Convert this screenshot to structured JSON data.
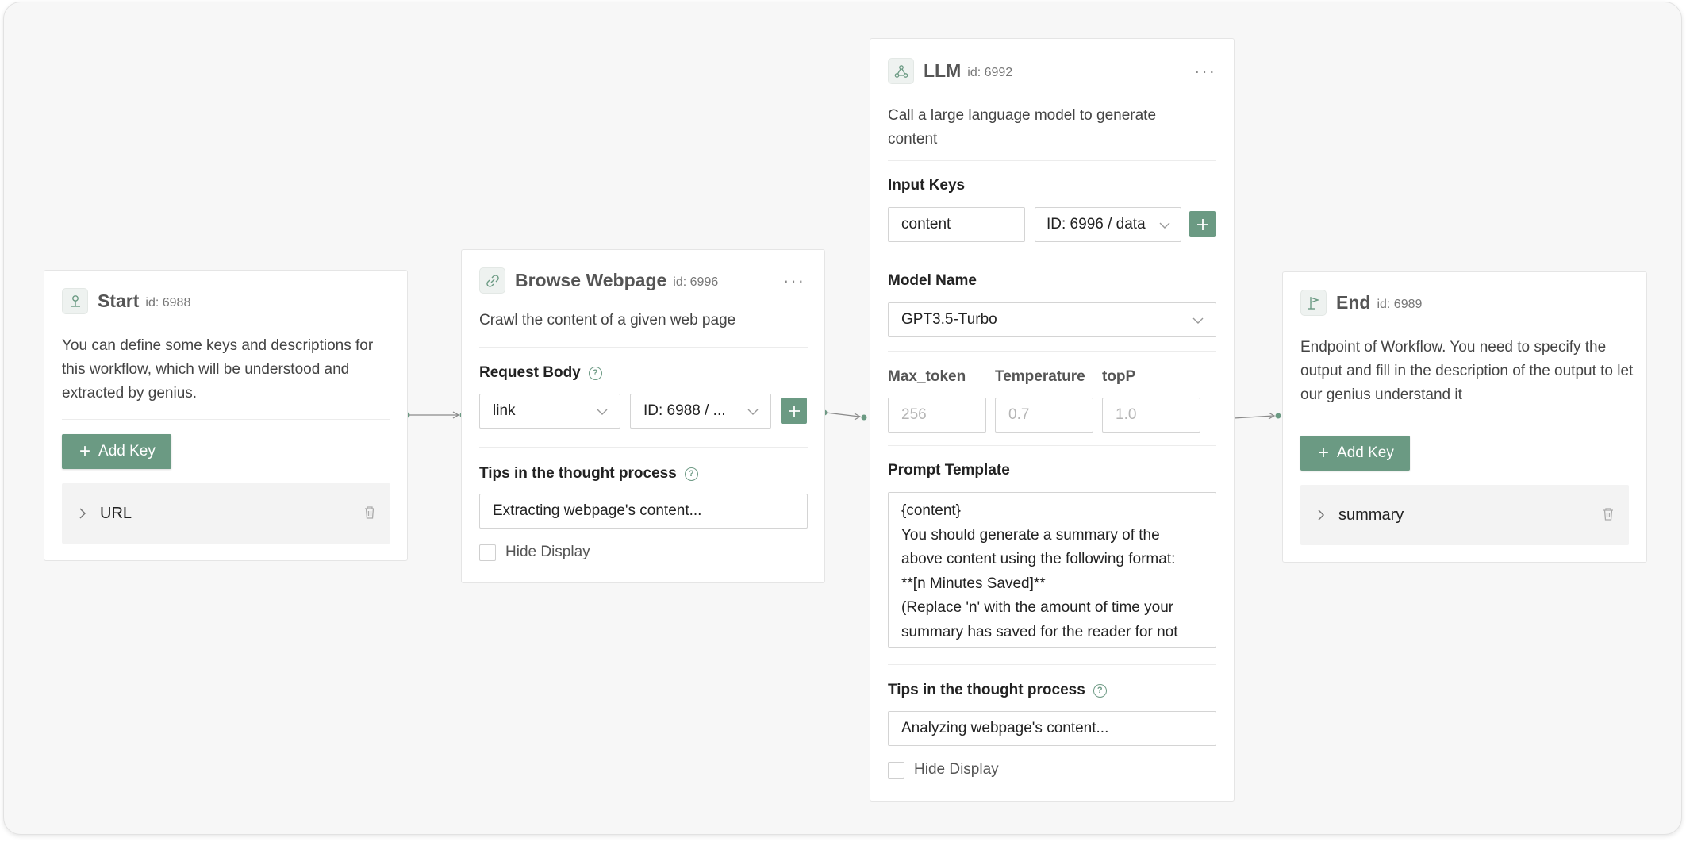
{
  "accent_color": "#6b9a83",
  "start": {
    "title": "Start",
    "id_label": "id: 6988",
    "description": "You can define some keys and descriptions for this workflow, which will be understood and extracted by genius.",
    "add_key_label": "Add Key",
    "keys": [
      "URL"
    ],
    "icon": "pin-icon"
  },
  "browse": {
    "title": "Browse Webpage",
    "id_label": "id: 6996",
    "more": "···",
    "description": "Crawl the content of a given web page",
    "request_body_label": "Request Body",
    "request_key_value": "link",
    "request_source_value": "ID: 6988 / ...",
    "tips_label": "Tips in the thought process",
    "tips_value": "Extracting webpage's content...",
    "hide_display_label": "Hide Display",
    "icon": "link-icon"
  },
  "llm": {
    "title": "LLM",
    "id_label": "id: 6992",
    "more": "···",
    "description": "Call a large language model to generate content",
    "input_keys_label": "Input Keys",
    "input_key_value": "content",
    "input_source_value": "ID: 6996 / data",
    "model_name_label": "Model Name",
    "model_name_value": "GPT3.5-Turbo",
    "max_token_label": "Max_token",
    "max_token_placeholder": "256",
    "temperature_label": "Temperature",
    "temperature_placeholder": "0.7",
    "top_p_label": "topP",
    "top_p_placeholder": "1.0",
    "prompt_template_label": "Prompt Template",
    "prompt_template_value": "{content}\nYou should generate a summary of the above content using the following format:\n**[n Minutes Saved]**\n(Replace 'n' with the amount of time your summary has saved for the reader for not",
    "tips_label": "Tips in the thought process",
    "tips_value": "Analyzing webpage's content...",
    "hide_display_label": "Hide Display",
    "icon": "network-icon"
  },
  "end": {
    "title": "End",
    "id_label": "id: 6989",
    "description": "Endpoint of Workflow. You need to specify the output and fill in the description of the output to let our genius understand it",
    "add_key_label": "Add Key",
    "keys": [
      "summary"
    ],
    "icon": "flag-icon"
  }
}
